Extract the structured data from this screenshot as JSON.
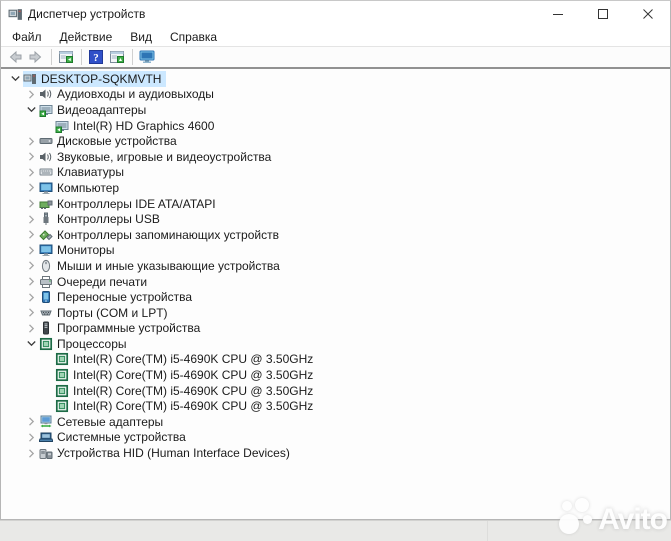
{
  "window": {
    "title": "Диспетчер устройств"
  },
  "menu": {
    "items": [
      "Файл",
      "Действие",
      "Вид",
      "Справка"
    ]
  },
  "toolbar": {
    "buttons": [
      {
        "icon": "back-arrow"
      },
      {
        "icon": "forward-arrow"
      },
      {
        "icon": "separator"
      },
      {
        "icon": "console-window"
      },
      {
        "icon": "separator"
      },
      {
        "icon": "help"
      },
      {
        "icon": "properties-window"
      },
      {
        "icon": "separator"
      },
      {
        "icon": "scan-computer"
      }
    ]
  },
  "tree": {
    "items": [
      {
        "label": "DESKTOP-SQKMVTH",
        "level": 0,
        "state": "expanded",
        "icon": "computer-root",
        "selected": true
      },
      {
        "label": "Аудиовходы и аудиовыходы",
        "level": 1,
        "state": "collapsed",
        "icon": "audio-endpoint"
      },
      {
        "label": "Видеоадаптеры",
        "level": 1,
        "state": "expanded",
        "icon": "display-adapter"
      },
      {
        "label": "Intel(R) HD Graphics 4600",
        "level": 2,
        "state": "leaf",
        "icon": "display-adapter"
      },
      {
        "label": "Дисковые устройства",
        "level": 1,
        "state": "collapsed",
        "icon": "disk-drive"
      },
      {
        "label": "Звуковые, игровые и видеоустройства",
        "level": 1,
        "state": "collapsed",
        "icon": "audio-endpoint"
      },
      {
        "label": "Клавиатуры",
        "level": 1,
        "state": "collapsed",
        "icon": "keyboard"
      },
      {
        "label": "Компьютер",
        "level": 1,
        "state": "collapsed",
        "icon": "monitor"
      },
      {
        "label": "Контроллеры IDE ATA/ATAPI",
        "level": 1,
        "state": "collapsed",
        "icon": "ide-controller"
      },
      {
        "label": "Контроллеры USB",
        "level": 1,
        "state": "collapsed",
        "icon": "usb-controller"
      },
      {
        "label": "Контроллеры запоминающих устройств",
        "level": 1,
        "state": "collapsed",
        "icon": "storage-controller"
      },
      {
        "label": "Мониторы",
        "level": 1,
        "state": "collapsed",
        "icon": "monitor"
      },
      {
        "label": "Мыши и иные указывающие устройства",
        "level": 1,
        "state": "collapsed",
        "icon": "mouse"
      },
      {
        "label": "Очереди печати",
        "level": 1,
        "state": "collapsed",
        "icon": "printer"
      },
      {
        "label": "Переносные устройства",
        "level": 1,
        "state": "collapsed",
        "icon": "portable-device"
      },
      {
        "label": "Порты (COM и LPT)",
        "level": 1,
        "state": "collapsed",
        "icon": "port"
      },
      {
        "label": "Программные устройства",
        "level": 1,
        "state": "collapsed",
        "icon": "software-device"
      },
      {
        "label": "Процессоры",
        "level": 1,
        "state": "expanded",
        "icon": "processor"
      },
      {
        "label": "Intel(R) Core(TM) i5-4690K CPU @ 3.50GHz",
        "level": 2,
        "state": "leaf",
        "icon": "processor"
      },
      {
        "label": "Intel(R) Core(TM) i5-4690K CPU @ 3.50GHz",
        "level": 2,
        "state": "leaf",
        "icon": "processor"
      },
      {
        "label": "Intel(R) Core(TM) i5-4690K CPU @ 3.50GHz",
        "level": 2,
        "state": "leaf",
        "icon": "processor"
      },
      {
        "label": "Intel(R) Core(TM) i5-4690K CPU @ 3.50GHz",
        "level": 2,
        "state": "leaf",
        "icon": "processor"
      },
      {
        "label": "Сетевые адаптеры",
        "level": 1,
        "state": "collapsed",
        "icon": "network-adapter"
      },
      {
        "label": "Системные устройства",
        "level": 1,
        "state": "collapsed",
        "icon": "system-device"
      },
      {
        "label": "Устройства HID (Human Interface Devices)",
        "level": 1,
        "state": "collapsed",
        "icon": "hid-device"
      }
    ]
  },
  "watermark": {
    "text": "Avito"
  },
  "colors": {
    "selection": "#cce8ff",
    "toolbar_border": "#919191",
    "strip": "#e9e9e7"
  }
}
